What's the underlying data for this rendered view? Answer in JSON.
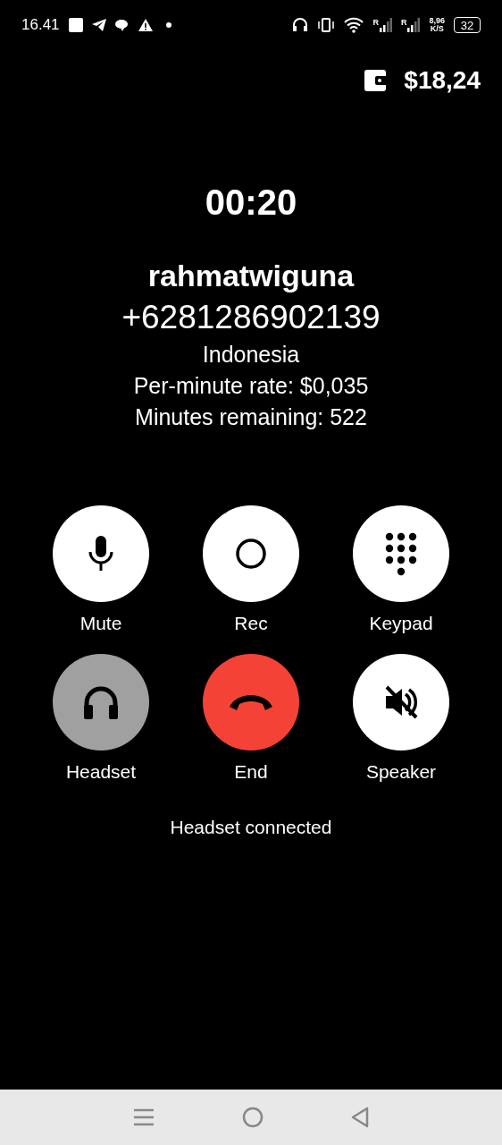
{
  "status_bar": {
    "time": "16.41",
    "signal_labels": [
      "R",
      "R"
    ],
    "speed": "8,96",
    "speed_unit": "K/S",
    "battery": "32"
  },
  "balance": "$18,24",
  "call": {
    "timer": "00:20",
    "name": "rahmatwiguna",
    "number": "+6281286902139",
    "country": "Indonesia",
    "rate": "Per-minute rate: $0,035",
    "remaining": "Minutes remaining: 522"
  },
  "buttons": [
    {
      "kind": "mute",
      "label": "Mute",
      "on": false
    },
    {
      "kind": "rec",
      "label": "Rec",
      "on": false
    },
    {
      "kind": "keypad",
      "label": "Keypad",
      "on": false
    },
    {
      "kind": "headset",
      "label": "Headset",
      "on": true
    },
    {
      "kind": "end",
      "label": "End",
      "on": false
    },
    {
      "kind": "speaker",
      "label": "Speaker",
      "on": false
    }
  ],
  "status_message": "Headset connected"
}
